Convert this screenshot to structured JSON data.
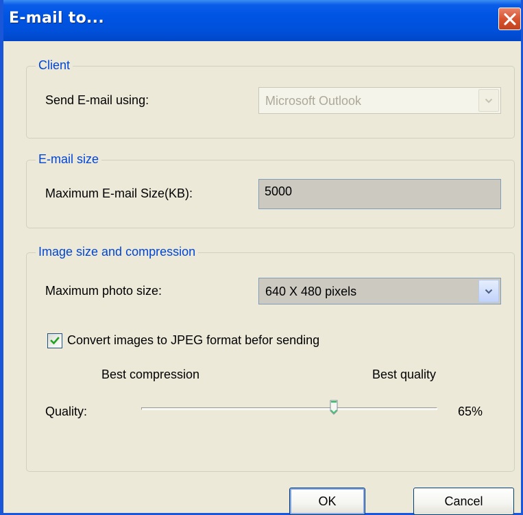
{
  "window": {
    "title": "E-mail to...",
    "close_icon": "close-icon"
  },
  "client": {
    "group_label": "Client",
    "send_label": "Send E-mail using:",
    "send_value": "Microsoft Outlook",
    "send_disabled": true
  },
  "email_size": {
    "group_label": "E-mail size",
    "max_label": "Maximum E-mail Size(KB):",
    "max_value": "5000"
  },
  "image": {
    "group_label": "Image size and compression",
    "photo_label": "Maximum photo size:",
    "photo_value": "640 X 480 pixels",
    "convert_label": "Convert images to JPEG format befor sending",
    "convert_checked": true,
    "best_compression_label": "Best compression",
    "best_quality_label": "Best quality",
    "quality_label": "Quality:",
    "quality_value": "65%",
    "quality_fraction": 0.65
  },
  "buttons": {
    "ok": "OK",
    "cancel": "Cancel"
  },
  "colors": {
    "titlebar_blue": "#0054e3",
    "group_label_blue": "#0046d5",
    "close_red": "#d8542f",
    "check_green": "#21a121"
  }
}
